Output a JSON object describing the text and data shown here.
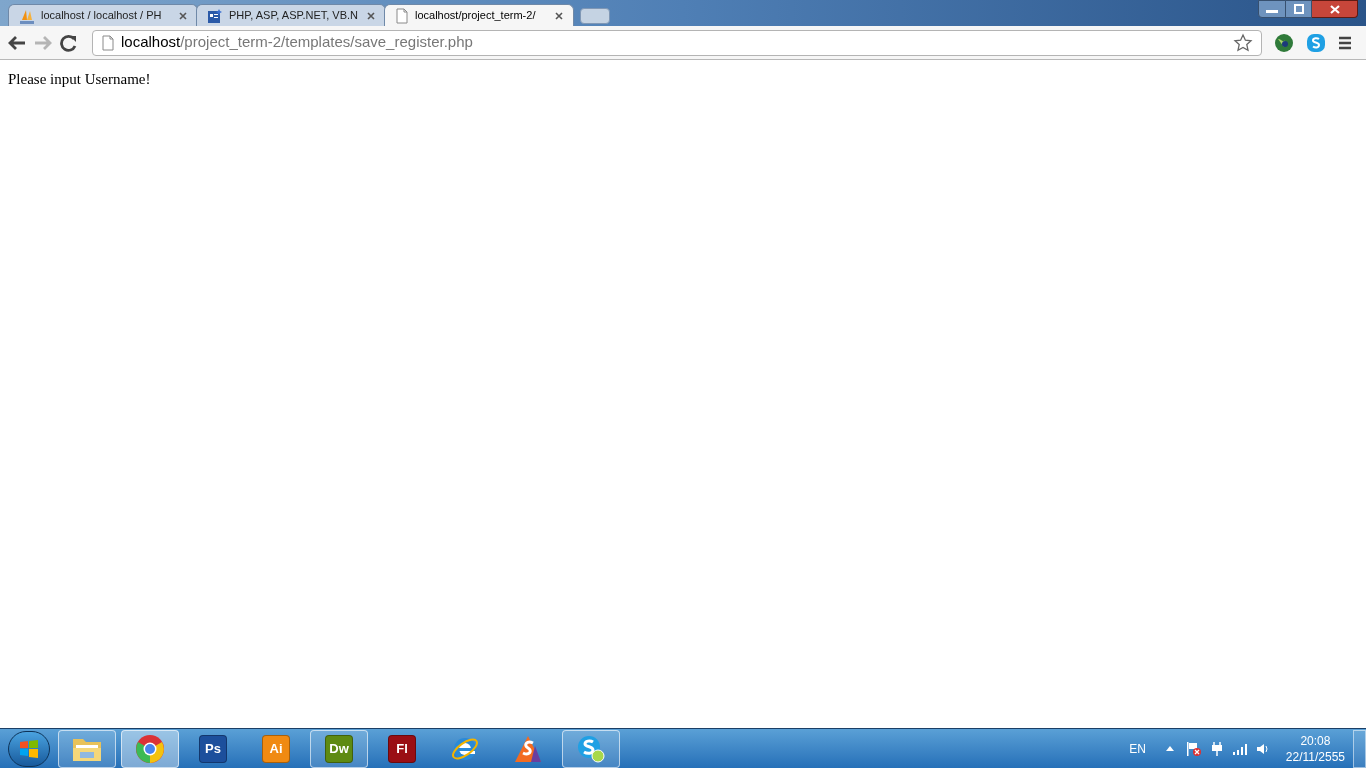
{
  "tabs": [
    {
      "title": "localhost / localhost / PH",
      "kind": "pma",
      "selected": false
    },
    {
      "title": "PHP, ASP, ASP.NET, VB.N",
      "kind": "doc",
      "selected": false
    },
    {
      "title": "localhost/project_term-2/",
      "kind": "page",
      "selected": true
    }
  ],
  "address": {
    "host": "localhost",
    "path": "/project_term-2/templates/save_register.php"
  },
  "toolbar": {
    "forward_disabled": true
  },
  "page": {
    "message": "Please input Username!"
  },
  "taskbar": {
    "items": [
      {
        "kind": "folder",
        "running": true,
        "selected": false
      },
      {
        "kind": "chrome",
        "running": true,
        "selected": true
      },
      {
        "kind": "tile",
        "label": "Ps",
        "color": "#1c4f9c",
        "running": false,
        "selected": false
      },
      {
        "kind": "tile",
        "label": "Ai",
        "color": "#f08a12",
        "running": false,
        "selected": false
      },
      {
        "kind": "tile",
        "label": "Dw",
        "color": "#5e8a12",
        "running": true,
        "selected": false
      },
      {
        "kind": "tile",
        "label": "Fl",
        "color": "#9a0e14",
        "running": false,
        "selected": false
      },
      {
        "kind": "ie",
        "running": false,
        "selected": false
      },
      {
        "kind": "swoosh",
        "running": false,
        "selected": false
      },
      {
        "kind": "skype",
        "running": true,
        "selected": false
      }
    ],
    "language": "EN",
    "time": "20:08",
    "date": "22/11/2555"
  }
}
